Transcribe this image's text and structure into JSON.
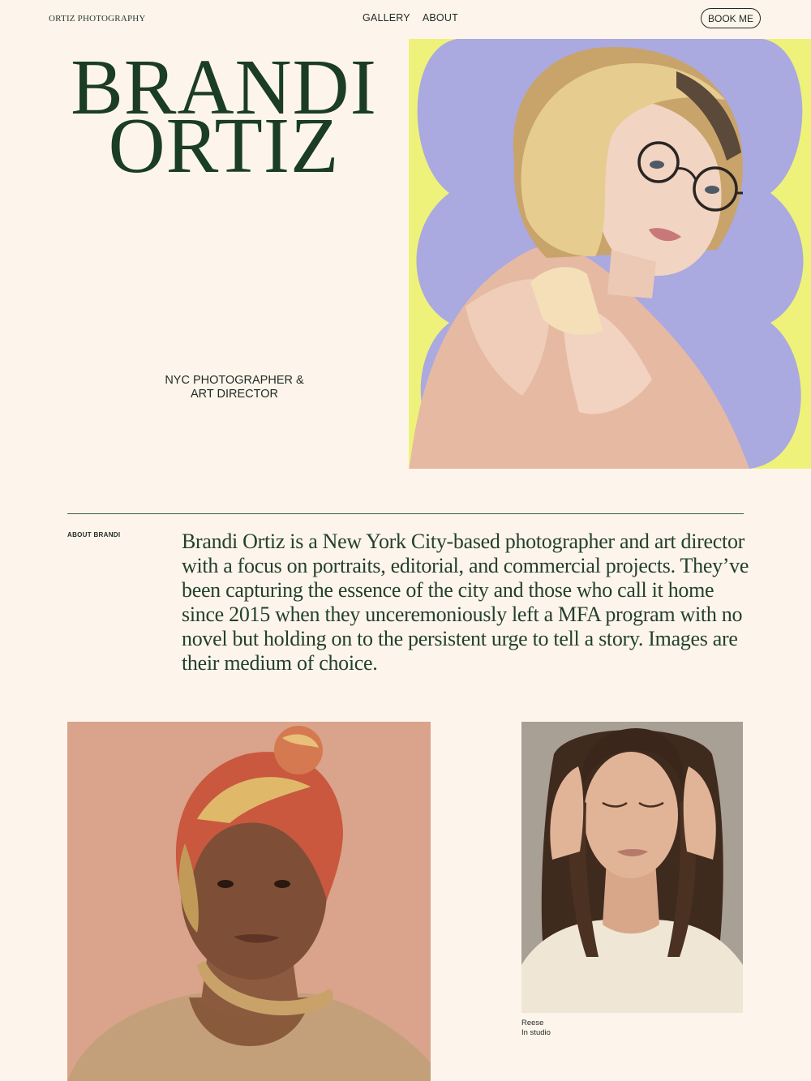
{
  "nav": {
    "logo": "ORTIZ PHOTOGRAPHY",
    "links": [
      "GALLERY",
      "ABOUT"
    ],
    "cta": "BOOK ME"
  },
  "hero": {
    "title_line1": "BRANDI",
    "title_line2": "ORTIZ",
    "tagline_line1": "NYC PHOTOGRAPHER &",
    "tagline_line2": "ART DIRECTOR"
  },
  "about": {
    "label": "ABOUT BRANDI",
    "text": "Brandi Ortiz is a New York City-based photographer and art director with a focus on portraits, editorial, and commercial projects. They’ve been capturing the essence of the city and those who call it home since 2015 when they unceremoniously left a MFA program with no novel but holding on to the persistent urge to tell a story. Images are their medium of choice."
  },
  "gallery": {
    "caption_name": "Reese",
    "caption_detail": "In studio"
  },
  "colors": {
    "background": "#fdf5ec",
    "brand_green": "#1a3d24",
    "hero_yellow": "#eef27a",
    "hero_lavender": "#aaa9e0"
  }
}
